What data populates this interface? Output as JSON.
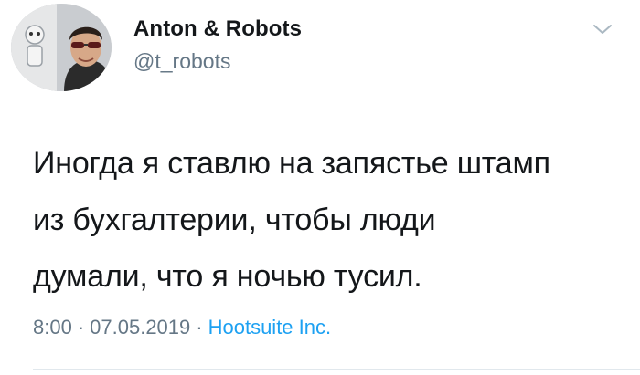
{
  "tweet": {
    "author": {
      "display_name": "Anton & Robots",
      "handle": "@t_robots",
      "avatar_icon": "profile-photo"
    },
    "menu_icon": "chevron-down-icon",
    "text": "Иногда я ставлю на запястье штамп\nиз бухгалтерии, чтобы люди\nдумали, что я ночью тусил.",
    "meta": {
      "time": "8:00",
      "separator": "·",
      "date": "07.05.2019",
      "source": "Hootsuite Inc."
    },
    "colors": {
      "text": "#14171a",
      "secondary": "#657786",
      "link": "#1da1f2",
      "divider": "#e1e8ed"
    }
  }
}
